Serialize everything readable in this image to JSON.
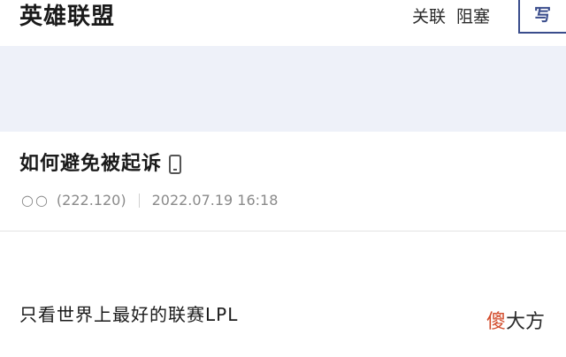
{
  "header": {
    "gallery_title": "英雄联盟",
    "follow_label": "关联",
    "block_label": "阻塞",
    "write_label": "写"
  },
  "post": {
    "title": "如何避免被起诉",
    "author_name": "○○",
    "author_ip": "(222.120)",
    "timestamp": "2022.07.19 16:18",
    "body_text": "只看世界上最好的联赛LPL"
  },
  "watermark": {
    "char_1": "傻",
    "chars_rest": "大方"
  },
  "icons": {
    "device": "mobile-phone-icon"
  },
  "colors": {
    "banner_bg": "#eef1f9",
    "write_accent": "#3a4d8c",
    "meta_text": "#8a8a8a",
    "watermark_accent": "#d24a2a"
  }
}
